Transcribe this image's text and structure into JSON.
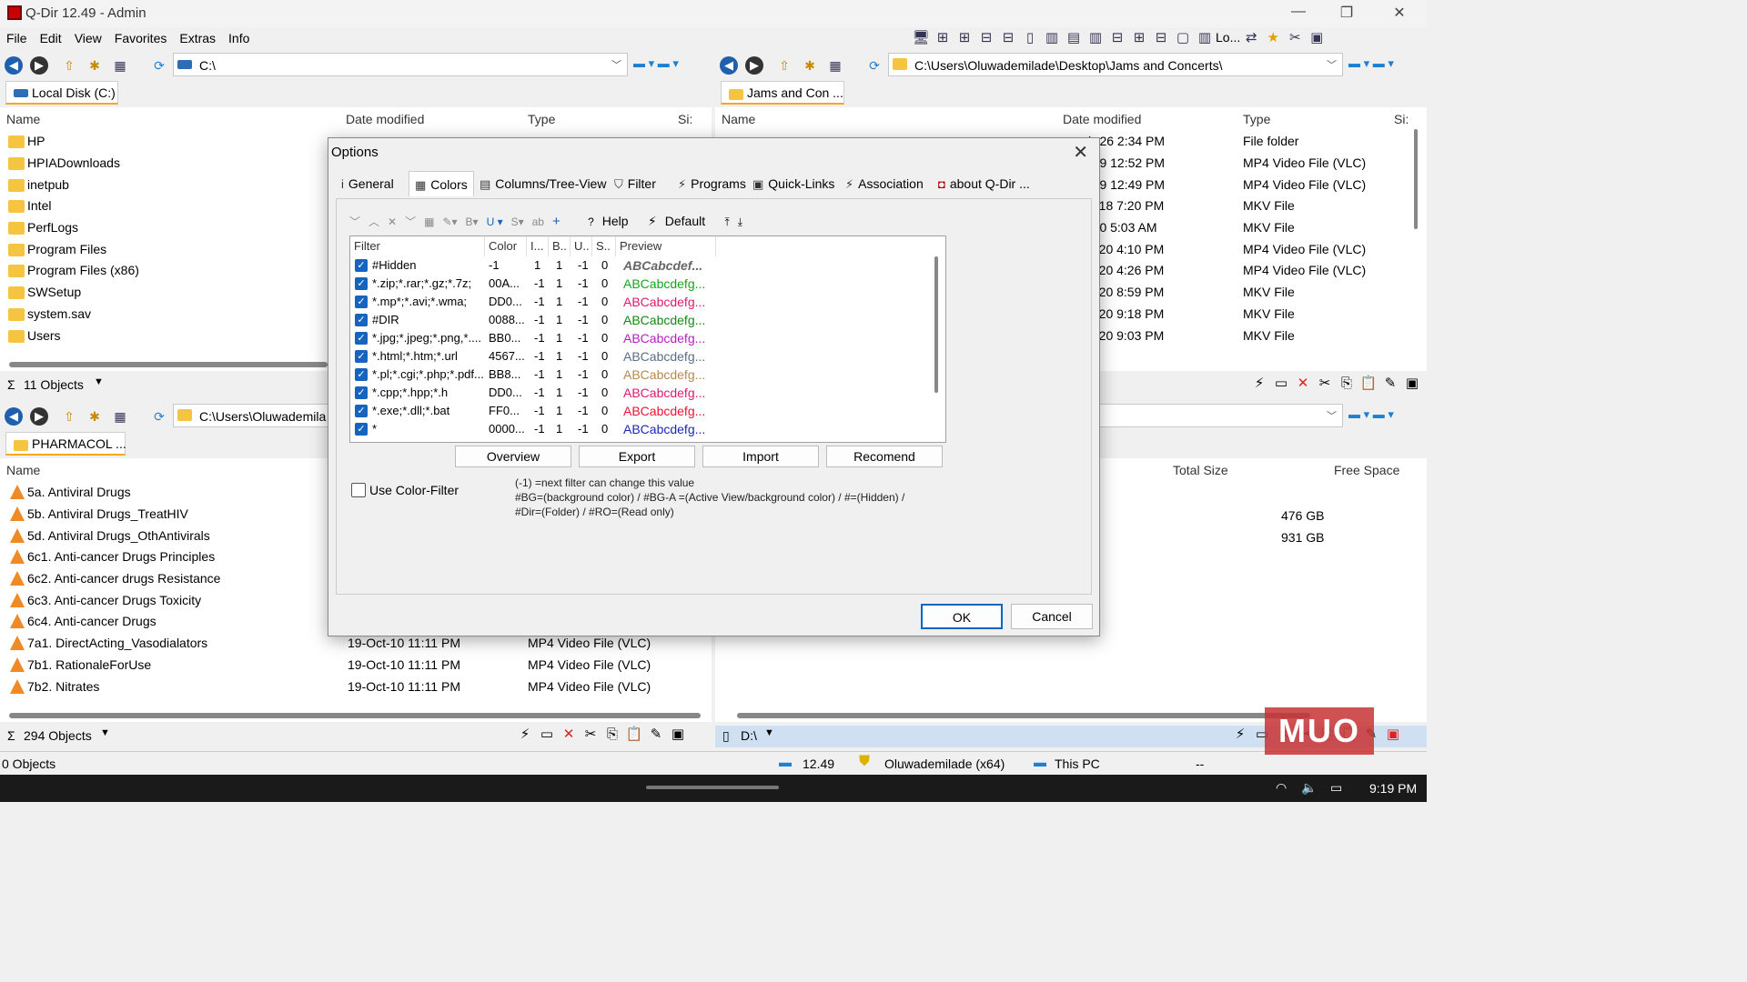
{
  "window": {
    "title": "Q-Dir 12.49 - Admin"
  },
  "menu": [
    "File",
    "Edit",
    "View",
    "Favorites",
    "Extras",
    "Info"
  ],
  "toolbar_right": {
    "lo_label": "Lo..."
  },
  "panes": {
    "top_left": {
      "address": "C:\\",
      "tab": "Local Disk (C:)",
      "columns": [
        "Name",
        "Date modified",
        "Type",
        "Si:"
      ],
      "rows": [
        {
          "name": "HP",
          "date": "",
          "type": ""
        },
        {
          "name": "HPIADownloads",
          "date": "",
          "type": ""
        },
        {
          "name": "inetpub",
          "date": "",
          "type": ""
        },
        {
          "name": "Intel",
          "date": "",
          "type": ""
        },
        {
          "name": "PerfLogs",
          "date": "",
          "type": ""
        },
        {
          "name": "Program Files",
          "date": "",
          "type": ""
        },
        {
          "name": "Program Files (x86)",
          "date": "",
          "type": ""
        },
        {
          "name": "SWSetup",
          "date": "",
          "type": ""
        },
        {
          "name": "system.sav",
          "date": "",
          "type": ""
        },
        {
          "name": "Users",
          "date": "",
          "type": ""
        }
      ],
      "status": "11 Objects"
    },
    "top_right": {
      "address": "C:\\Users\\Oluwademilade\\Desktop\\Jams and Concerts\\",
      "tab": "Jams and Con ...",
      "columns": [
        "Name",
        "Date modified",
        "Type",
        "Si:"
      ],
      "rows": [
        {
          "date": "b-26 2:34 PM",
          "type": "File folder"
        },
        {
          "date": "-19 12:52 PM",
          "type": "MP4 Video File (VLC)"
        },
        {
          "date": "-19 12:49 PM",
          "type": "MP4 Video File (VLC)"
        },
        {
          "date": "v-18 7:20 PM",
          "type": "MKV File"
        },
        {
          "date": "-20 5:03 AM",
          "type": "MKV File"
        },
        {
          "date": "y-20 4:10 PM",
          "type": "MP4 Video File (VLC)"
        },
        {
          "date": "y-20 4:26 PM",
          "type": "MP4 Video File (VLC)"
        },
        {
          "date": "y-20 8:59 PM",
          "type": "MKV File"
        },
        {
          "date": "y-20 9:18 PM",
          "type": "MKV File"
        },
        {
          "date": "y-20 9:03 PM",
          "type": "MKV File"
        }
      ]
    },
    "bottom_left": {
      "address": "C:\\Users\\Oluwademila",
      "tab": "PHARMACOL ...",
      "columns": [
        "Name"
      ],
      "rows": [
        {
          "name": "5a.  Antiviral Drugs",
          "date": "",
          "type": ""
        },
        {
          "name": "5b.  Antiviral Drugs_TreatHIV",
          "date": "",
          "type": ""
        },
        {
          "name": "5d.  Antiviral Drugs_OthAntivirals",
          "date": "",
          "type": ""
        },
        {
          "name": "6c1.  Anti-cancer Drugs Principles",
          "date": "",
          "type": ""
        },
        {
          "name": "6c2.  Anti-cancer drugs Resistance",
          "date": "",
          "type": ""
        },
        {
          "name": "6c3.  Anti-cancer Drugs Toxicity",
          "date": "",
          "type": ""
        },
        {
          "name": "6c4.  Anti-cancer Drugs",
          "date": "",
          "type": ""
        },
        {
          "name": "7a1.  DirectActing_Vasodialators",
          "date": "19-Oct-10 11:11 PM",
          "type": "MP4 Video File (VLC)"
        },
        {
          "name": "7b1.  RationaleForUse",
          "date": "19-Oct-10 11:11 PM",
          "type": "MP4 Video File (VLC)"
        },
        {
          "name": "7b2.  Nitrates",
          "date": "19-Oct-10 11:11 PM",
          "type": "MP4 Video File (VLC)"
        }
      ],
      "status": "294 Objects"
    },
    "bottom_right": {
      "columns": [
        "Total Size",
        "Free Space"
      ],
      "rows": [
        {
          "total": "476 GB"
        },
        {
          "total": "931 GB"
        }
      ],
      "status": "D:\\"
    }
  },
  "bottom": {
    "objects": "0 Objects",
    "version": "12.49",
    "user": "Oluwademilade (x64)",
    "pc": "This PC",
    "dash": "--"
  },
  "taskbar": {
    "time": "9:19 PM"
  },
  "watermark": "MUO",
  "dialog": {
    "title": "Options",
    "tabs": [
      {
        "icon": "i",
        "label": "General"
      },
      {
        "icon": "▦",
        "label": "Colors"
      },
      {
        "icon": "▤",
        "label": "Columns/Tree-View"
      },
      {
        "icon": "⛉",
        "label": "Filter"
      },
      {
        "icon": "⚡",
        "label": "Programs"
      },
      {
        "icon": "▣",
        "label": "Quick-Links"
      },
      {
        "icon": "⚡",
        "label": "Association"
      },
      {
        "icon": "◘",
        "label": "about Q-Dir ..."
      }
    ],
    "toolbar": {
      "help": "Help",
      "default": "Default"
    },
    "grid": {
      "headers": [
        "Filter",
        "Color",
        "I...",
        "B..",
        "U..",
        "S..",
        "Preview"
      ],
      "rows": [
        {
          "filter": "#Hidden",
          "color": "-1",
          "i": "1",
          "b": "1",
          "u": "-1",
          "s": "0",
          "preview": "ABCabcdef...",
          "pcolor": "#666666"
        },
        {
          "filter": "*.zip;*.rar;*.gz;*.7z;",
          "color": "00A...",
          "i": "-1",
          "b": "1",
          "u": "-1",
          "s": "0",
          "preview": "ABCabcdefg...",
          "pcolor": "#17a51d"
        },
        {
          "filter": "*.mp*;*.avi;*.wma;",
          "color": "DD0...",
          "i": "-1",
          "b": "1",
          "u": "-1",
          "s": "0",
          "preview": "ABCabcdefg...",
          "pcolor": "#dd1a6e"
        },
        {
          "filter": "#DIR",
          "color": "0088...",
          "i": "-1",
          "b": "1",
          "u": "-1",
          "s": "0",
          "preview": "ABCabcdefg...",
          "pcolor": "#128a12"
        },
        {
          "filter": "*.jpg;*.jpeg;*.png,*....",
          "color": "BB0...",
          "i": "-1",
          "b": "1",
          "u": "-1",
          "s": "0",
          "preview": "ABCabcdefg...",
          "pcolor": "#b51fbf"
        },
        {
          "filter": "*.html;*.htm;*.url",
          "color": "4567...",
          "i": "-1",
          "b": "1",
          "u": "-1",
          "s": "0",
          "preview": "ABCabcdefg...",
          "pcolor": "#5a6d8a"
        },
        {
          "filter": "*.pl;*.cgi;*.php;*.pdf...",
          "color": "BB8...",
          "i": "-1",
          "b": "1",
          "u": "-1",
          "s": "0",
          "preview": "ABCabcdefg...",
          "pcolor": "#b8894d"
        },
        {
          "filter": "*.cpp;*.hpp;*.h",
          "color": "DD0...",
          "i": "-1",
          "b": "1",
          "u": "-1",
          "s": "0",
          "preview": "ABCabcdefg...",
          "pcolor": "#dd1a6e"
        },
        {
          "filter": "*.exe;*.dll;*.bat",
          "color": "FF0...",
          "i": "-1",
          "b": "1",
          "u": "-1",
          "s": "0",
          "preview": "ABCabcdefg...",
          "pcolor": "#ee1133"
        },
        {
          "filter": "*",
          "color": "0000...",
          "i": "-1",
          "b": "1",
          "u": "-1",
          "s": "0",
          "preview": "ABCabcdefg...",
          "pcolor": "#1a2ab5"
        }
      ]
    },
    "buttons": {
      "overview": "Overview",
      "export": "Export",
      "import": "Import",
      "recomend": "Recomend",
      "ok": "OK",
      "cancel": "Cancel"
    },
    "use_color_filter": "Use Color-Filter",
    "notes": [
      "(-1) =next filter can change this value",
      "#BG=(background color) / #BG-A =(Active View/background color) / #=(Hidden) /",
      "#Dir=(Folder) / #RO=(Read only)"
    ]
  }
}
